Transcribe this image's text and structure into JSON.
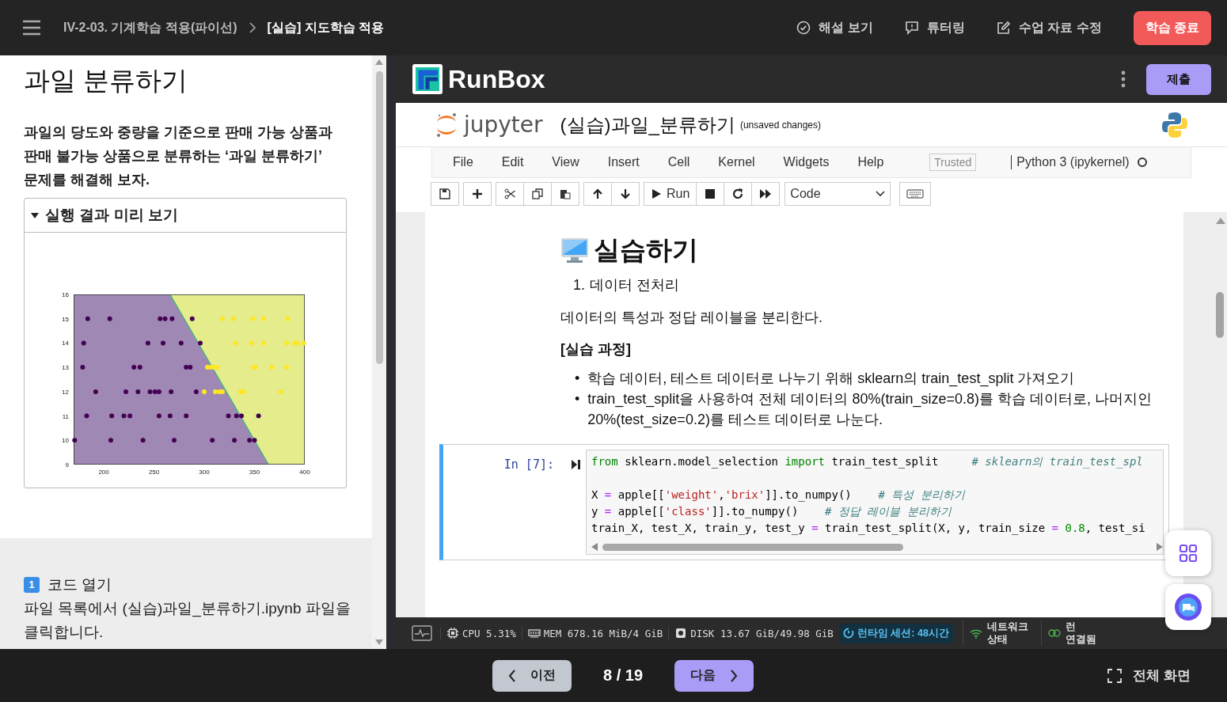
{
  "top_bar": {
    "breadcrumb": [
      {
        "label": "IV-2-03. 기계학습 적용(파이선)",
        "current": false
      },
      {
        "label": "[실습] 지도학습 적용",
        "current": true
      }
    ],
    "actions": [
      {
        "kind": "check",
        "label": "해설 보기"
      },
      {
        "kind": "chat",
        "label": "튜터링"
      },
      {
        "kind": "edit",
        "label": "수업 자료 수정"
      }
    ],
    "end_button": "학습 종료"
  },
  "lesson": {
    "title": "과일 분류하기",
    "intro": "과일의 당도와 중량을 기준으로 판매 가능 상품과 판매 불가능 상품으로 분류하는 ‘과일 분류하기’ 문제를 해결해 보자.",
    "preview": {
      "label": "실행 결과 미리 보기",
      "expanded": true,
      "chart_data": {
        "type": "scatter",
        "xlim": [
          170,
          400
        ],
        "ylim": [
          9,
          16
        ],
        "xticks": [
          200,
          250,
          300,
          350,
          400
        ],
        "yticks": [
          9,
          10,
          11,
          12,
          13,
          14,
          15,
          16
        ],
        "series": [
          {
            "color": "#440154",
            "x": [
              184,
              206,
              256,
              261,
              268,
              288,
              180,
              244,
              259,
              277,
              296,
              179,
              230,
              236,
              282,
              286,
              192,
              222,
              234,
              246,
              251,
              255,
              267,
              292,
              183,
              208,
              220,
              226,
              255,
              266,
              282,
              324,
              332,
              337,
              354,
              171,
              207,
              239,
              270,
              308,
              330,
              345,
              350
            ],
            "values": [
              15,
              15,
              15,
              15,
              15,
              15,
              14,
              14,
              14,
              14,
              14,
              13,
              13,
              13,
              13,
              13,
              12,
              12,
              12,
              12,
              12,
              12,
              12,
              12,
              11,
              11,
              11,
              11,
              11,
              11,
              11,
              11,
              11,
              11,
              11,
              10,
              10,
              10,
              10,
              10,
              10,
              10,
              10
            ]
          },
          {
            "color": "#fde725",
            "x": [
              318,
              329,
              348,
              359,
              383,
              331,
              347,
              359,
              382,
              390,
              393,
              399,
              303,
              306,
              309,
              313,
              349,
              351,
              367,
              382,
              300,
              311,
              315,
              318,
              336,
              339,
              376
            ],
            "values": [
              15,
              15,
              15,
              15,
              15,
              14,
              14,
              14,
              14,
              14,
              14,
              14,
              13,
              13,
              13,
              13,
              13,
              13,
              13,
              13,
              12,
              12,
              12,
              12,
              12,
              12,
              12
            ]
          }
        ]
      }
    },
    "step": {
      "badge": "1",
      "title": "코드 열기",
      "text": "파일 목록에서 (실습)과일_분류하기.ipynb 파일을 클릭합니다."
    }
  },
  "runbox": {
    "logo": "RunBox",
    "submit": "제출",
    "notebook": {
      "brand": "jupyter",
      "name": "(실습)과일_분류하기",
      "save_status": "(unsaved changes)",
      "menu": [
        "File",
        "Edit",
        "View",
        "Insert",
        "Cell",
        "Kernel",
        "Widgets",
        "Help"
      ],
      "trusted": "Trusted",
      "kernel": "Python 3 (ipykernel)",
      "run_label": "Run",
      "cell_type": "Code"
    },
    "markdown": {
      "heading": "실습하기",
      "steps": [
        {
          "marker": "1.",
          "text": "데이터 전처리"
        }
      ],
      "paragraph": "데이터의 특성과 정답 레이블을 분리한다.",
      "subheading": "[실습 과정]",
      "bullets": [
        {
          "marker": "•",
          "text": "학습 데이터, 테스트 데이터로 나누기 위해 sklearn의 train_test_split 가져오기"
        },
        {
          "marker": "•",
          "text": "train_test_split을 사용하여 전체 데이터의 80%(train_size=0.8)를 학습 데이터로, 나머지인 20%(test_size=0.2)를 테스트 데이터로 나눈다."
        }
      ]
    },
    "code_cell": {
      "prompt": "In [7]:",
      "selected": true,
      "lines": [
        {
          "blank_before": false,
          "tokens": [
            {
              "kind": "kw",
              "text": "from"
            },
            {
              "kind": "plain",
              "text": " sklearn.model_selection "
            },
            {
              "kind": "kw",
              "text": "import"
            },
            {
              "kind": "plain",
              "text": " train_test_split     "
            },
            {
              "kind": "comment",
              "text": "# sklearn의 train_test_spl"
            }
          ]
        },
        {
          "blank_before": true,
          "tokens": [
            {
              "kind": "plain",
              "text": "X "
            },
            {
              "kind": "op",
              "text": "="
            },
            {
              "kind": "plain",
              "text": " apple[["
            },
            {
              "kind": "str",
              "text": "'weight'"
            },
            {
              "kind": "plain",
              "text": ","
            },
            {
              "kind": "str",
              "text": "'brix'"
            },
            {
              "kind": "plain",
              "text": "]].to_numpy()    "
            },
            {
              "kind": "comment",
              "text": "# 특성 분리하기"
            }
          ]
        },
        {
          "blank_before": false,
          "tokens": [
            {
              "kind": "plain",
              "text": "y "
            },
            {
              "kind": "op",
              "text": "="
            },
            {
              "kind": "plain",
              "text": " apple[["
            },
            {
              "kind": "str",
              "text": "'class'"
            },
            {
              "kind": "plain",
              "text": "]].to_numpy()    "
            },
            {
              "kind": "comment",
              "text": "# 정답 레이블 분리하기"
            }
          ]
        },
        {
          "blank_before": false,
          "tokens": [
            {
              "kind": "plain",
              "text": "train_X, test_X, train_y, test_y "
            },
            {
              "kind": "op",
              "text": "="
            },
            {
              "kind": "plain",
              "text": " train_test_split(X, y, train_size "
            },
            {
              "kind": "op",
              "text": "= "
            },
            {
              "kind": "num",
              "text": "0.8"
            },
            {
              "kind": "plain",
              "text": ", test_si"
            }
          ]
        }
      ]
    }
  },
  "status_bar": {
    "items": [
      {
        "kind": "cpu",
        "label": "CPU 5.31%"
      },
      {
        "kind": "mem",
        "label": "MEM 678.16 MiB/4 GiB"
      },
      {
        "kind": "disk",
        "label": "DISK 13.67 GiB/49.98 GiB"
      }
    ],
    "session": "런타임 세션: 48시간",
    "network": "네트워크 상태",
    "connection": "런 연결됨"
  },
  "pager": {
    "prev": "이전",
    "position": "8 / 19",
    "next": "다음",
    "fullscreen": "전체 화면"
  }
}
